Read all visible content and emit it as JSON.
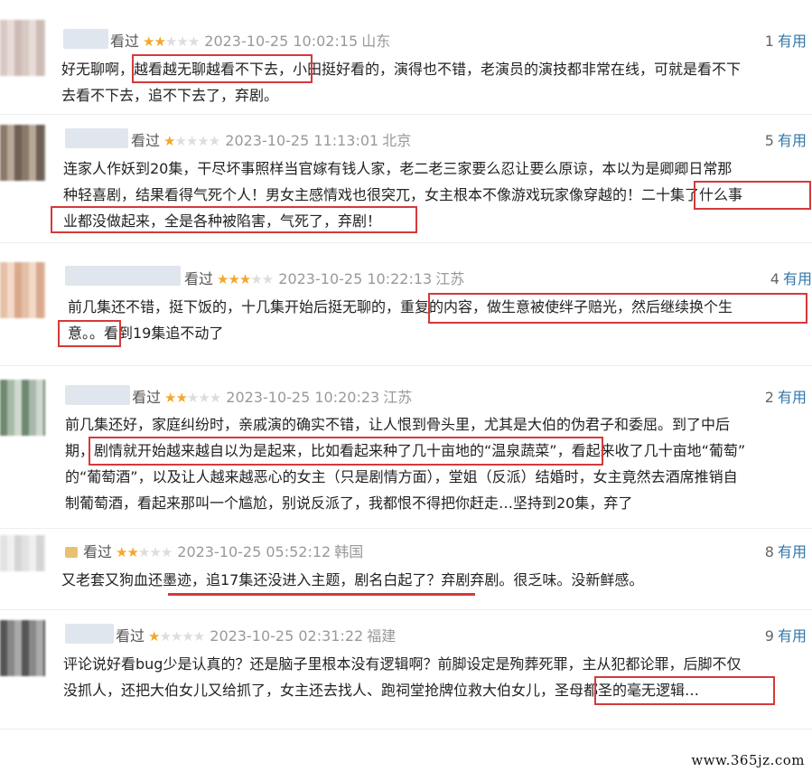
{
  "colors": {
    "accent_link": "#3377aa",
    "star_on": "#f3a72b",
    "star_off": "#dddddd",
    "highlight_red": "#d43a3a"
  },
  "reviews": [
    {
      "status": "看过",
      "stars": 2,
      "time": "2023-10-25 10:02:15",
      "location": "山东",
      "useful_count": "1",
      "useful_label": "有用",
      "lines": [
        "好无聊啊，越看越无聊越看不下去，小田挺好看的，演得也不错，老演员的演技都非常在线，可就是看不下",
        "去看不下去，追不下去了，弃剧。"
      ]
    },
    {
      "status": "看过",
      "stars": 1,
      "time": "2023-10-25 11:13:01",
      "location": "北京",
      "useful_count": "5",
      "useful_label": "有用",
      "lines": [
        "连家人作妖到20集，干尽坏事照样当官嫁有钱人家，老二老三家要么忍让要么原谅，本以为是卿卿日常那",
        "种轻喜剧，结果看得气死个人！男女主感情戏也很突兀，女主根本不像游戏玩家像穿越的！二十集了什么事",
        "业都没做起来，全是各种被陷害，气死了，弃剧！"
      ]
    },
    {
      "status": "看过",
      "stars": 3,
      "time": "2023-10-25 10:22:13",
      "location": "江苏",
      "useful_count": "4",
      "useful_label": "有用",
      "lines": [
        "前几集还不错，挺下饭的，十几集开始后挺无聊的，重复的内容，做生意被使绊子赔光，然后继续换个生",
        "意。。看到19集追不动了"
      ]
    },
    {
      "status": "看过",
      "stars": 2,
      "time": "2023-10-25 10:20:23",
      "location": "江苏",
      "useful_count": "2",
      "useful_label": "有用",
      "lines": [
        "前几集还好，家庭纠纷时，亲戚演的确实不错，让人恨到骨头里，尤其是大伯的伪君子和委屈。到了中后",
        "期，剧情就开始越来越自以为是起来，比如看起来种了几十亩地的“温泉蔬菜”，看起来收了几十亩地“葡萄”",
        "的“葡萄酒”，以及让人越来越恶心的女主（只是剧情方面），堂姐（反派）结婚时，女主竟然去酒席推销自",
        "制葡萄酒，看起来那叫一个尴尬，别说反派了，我都恨不得把你赶走…坚持到20集，弃了"
      ]
    },
    {
      "status": "看过",
      "stars": 2,
      "time": "2023-10-25 05:52:12",
      "location": "韩国",
      "useful_count": "8",
      "useful_label": "有用",
      "lines": [
        "又老套又狗血还墨迹，追17集还没进入主题，剧名白起了？弃剧弃剧。很乏味。没新鲜感。"
      ]
    },
    {
      "status": "看过",
      "stars": 1,
      "time": "2023-10-25 02:31:22",
      "location": "福建",
      "useful_count": "9",
      "useful_label": "有用",
      "lines": [
        "评论说好看bug少是认真的？还是脑子里根本没有逻辑啊？前脚设定是殉葬死罪，主从犯都论罪，后脚不仅",
        "没抓人，还把大伯女儿又给抓了，女主还去找人、跑祠堂抢牌位救大伯女儿，圣母都圣的毫无逻辑…"
      ]
    }
  ],
  "watermark": "www.365jz.com"
}
